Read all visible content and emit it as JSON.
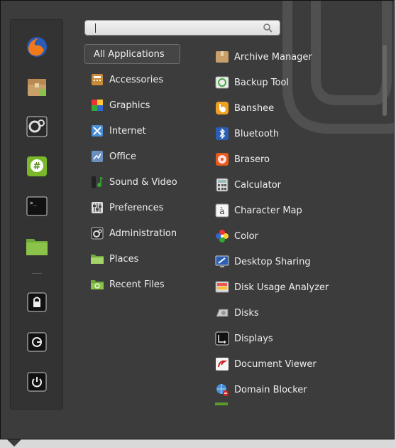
{
  "search": {
    "placeholder": ""
  },
  "favorites": [
    {
      "name": "firefox-icon"
    },
    {
      "name": "archive-manager-icon"
    },
    {
      "name": "system-settings-icon"
    },
    {
      "name": "hexchat-icon"
    },
    {
      "name": "terminal-icon"
    },
    {
      "name": "files-icon"
    },
    {
      "name": "lock-screen-icon"
    },
    {
      "name": "logout-icon"
    },
    {
      "name": "shutdown-icon"
    }
  ],
  "categories": [
    {
      "label": "All Applications"
    },
    {
      "label": "Accessories"
    },
    {
      "label": "Graphics"
    },
    {
      "label": "Internet"
    },
    {
      "label": "Office"
    },
    {
      "label": "Sound & Video"
    },
    {
      "label": "Preferences"
    },
    {
      "label": "Administration"
    },
    {
      "label": "Places"
    },
    {
      "label": "Recent Files"
    }
  ],
  "apps": [
    {
      "label": "Archive Manager"
    },
    {
      "label": "Backup Tool"
    },
    {
      "label": "Banshee"
    },
    {
      "label": "Bluetooth"
    },
    {
      "label": "Brasero"
    },
    {
      "label": "Calculator"
    },
    {
      "label": "Character Map"
    },
    {
      "label": "Color"
    },
    {
      "label": "Desktop Sharing"
    },
    {
      "label": "Disk Usage Analyzer"
    },
    {
      "label": "Disks"
    },
    {
      "label": "Displays"
    },
    {
      "label": "Document Viewer"
    },
    {
      "label": "Domain Blocker"
    }
  ]
}
